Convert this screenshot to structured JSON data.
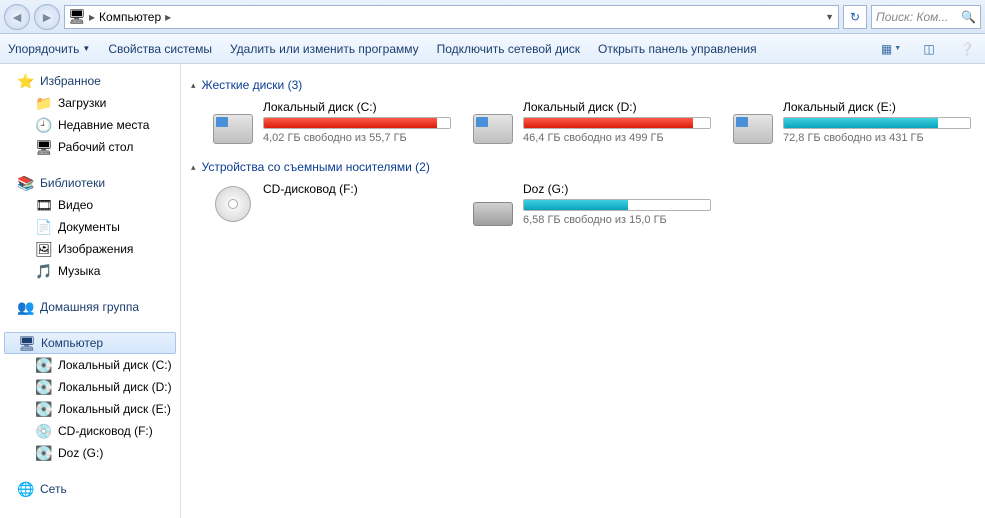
{
  "addressbar": {
    "location_label": "Компьютер",
    "search_placeholder": "Поиск: Ком..."
  },
  "toolbar": {
    "organize": "Упорядочить",
    "system_props": "Свойства системы",
    "uninstall": "Удалить или изменить программу",
    "map_drive": "Подключить сетевой диск",
    "control_panel": "Открыть панель управления"
  },
  "sidebar": {
    "favorites": {
      "label": "Избранное",
      "items": [
        "Загрузки",
        "Недавние места",
        "Рабочий стол"
      ]
    },
    "libraries": {
      "label": "Библиотеки",
      "items": [
        "Видео",
        "Документы",
        "Изображения",
        "Музыка"
      ]
    },
    "homegroup": {
      "label": "Домашняя группа"
    },
    "computer": {
      "label": "Компьютер",
      "items": [
        "Локальный диск (C:)",
        "Локальный диск (D:)",
        "Локальный диск (E:)",
        "CD-дисковод (F:)",
        "Doz (G:)"
      ]
    },
    "network": {
      "label": "Сеть"
    }
  },
  "content": {
    "group_hdd": "Жесткие диски (3)",
    "group_removable": "Устройства со съемными носителями (2)",
    "drives_hdd": [
      {
        "name": "Локальный диск (C:)",
        "sub": "4,02 ГБ свободно из 55,7 ГБ",
        "fill": 93,
        "color": "red"
      },
      {
        "name": "Локальный диск (D:)",
        "sub": "46,4 ГБ свободно из 499 ГБ",
        "fill": 91,
        "color": "red"
      },
      {
        "name": "Локальный диск (E:)",
        "sub": "72,8 ГБ свободно из 431 ГБ",
        "fill": 83,
        "color": "teal"
      }
    ],
    "drives_removable": [
      {
        "name": "CD-дисковод (F:)",
        "sub": "",
        "fill": null,
        "icon": "cd"
      },
      {
        "name": "Doz (G:)",
        "sub": "6,58 ГБ свободно из 15,0 ГБ",
        "fill": 56,
        "color": "teal",
        "icon": "usb"
      }
    ]
  }
}
